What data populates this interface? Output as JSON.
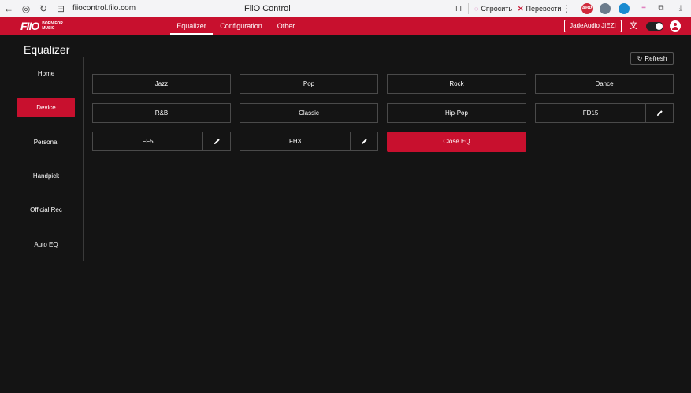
{
  "browser": {
    "url": "fiiocontrol.fiio.com",
    "title": "FiiO Control",
    "ask_label": "Спросить",
    "translate_label": "Перевести",
    "extensions": [
      "ABP"
    ]
  },
  "header": {
    "logo_text": "FIIO",
    "logo_tagline": "BORN FOR MUSIC",
    "tabs": [
      {
        "label": "Equalizer",
        "active": true
      },
      {
        "label": "Configuration",
        "active": false
      },
      {
        "label": "Other",
        "active": false
      }
    ],
    "user_label": "JadeAudio JIEZI"
  },
  "page": {
    "title": "Equalizer",
    "refresh_label": "Refresh"
  },
  "sidebar": {
    "items": [
      {
        "label": "Home",
        "active": false
      },
      {
        "label": "Device",
        "active": true
      },
      {
        "label": "Personal",
        "active": false
      },
      {
        "label": "Handpick",
        "active": false
      },
      {
        "label": "Official Rec",
        "active": false
      },
      {
        "label": "Auto EQ",
        "active": false
      }
    ]
  },
  "presets": [
    {
      "label": "Jazz",
      "editable": false
    },
    {
      "label": "Pop",
      "editable": false
    },
    {
      "label": "Rock",
      "editable": false
    },
    {
      "label": "Dance",
      "editable": false
    },
    {
      "label": "R&B",
      "editable": false
    },
    {
      "label": "Classic",
      "editable": false
    },
    {
      "label": "Hip-Pop",
      "editable": false
    },
    {
      "label": "FD15",
      "editable": true
    },
    {
      "label": "FF5",
      "editable": true
    },
    {
      "label": "FH3",
      "editable": true
    }
  ],
  "close_eq_label": "Close EQ",
  "colors": {
    "accent": "#c8102e",
    "background": "#141414"
  }
}
